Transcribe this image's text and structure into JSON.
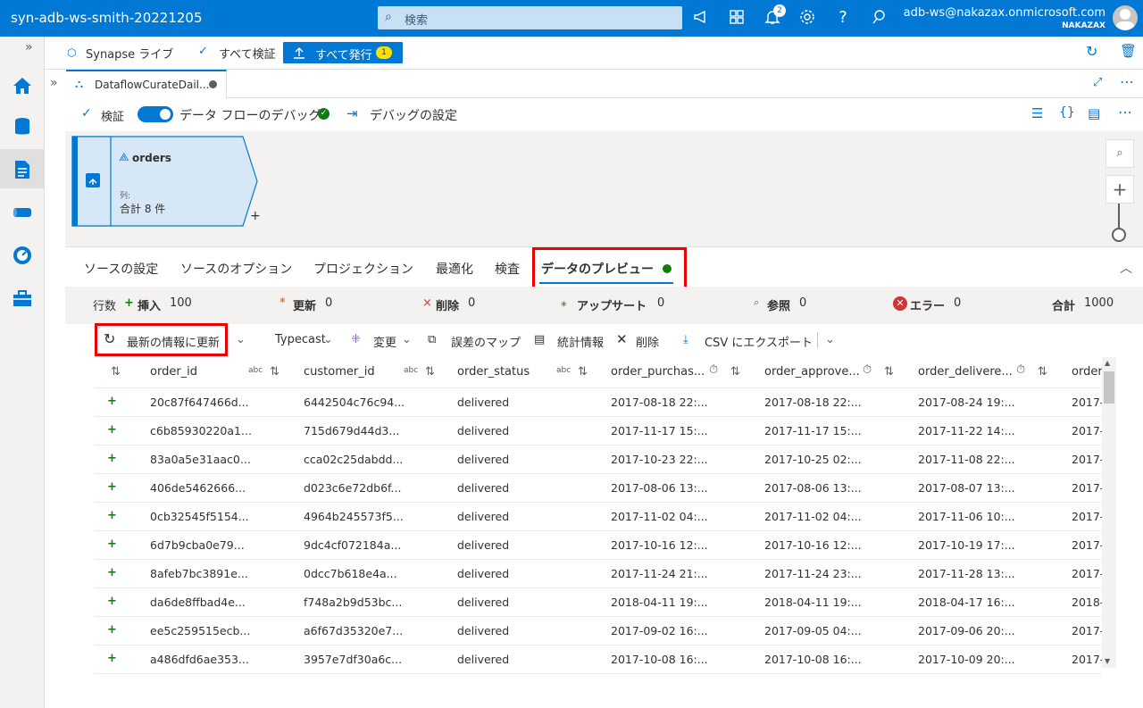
{
  "topbar": {
    "workspace": "syn-adb-ws-smith-20221205",
    "search_placeholder": "検索",
    "notif_count": "2",
    "user_email": "adb-ws@nakazax.onmicrosoft.com",
    "user_tenant": "NAKAZAX"
  },
  "toolbar2": {
    "synapse_live": "Synapse ライブ",
    "validate_all": "すべて検証",
    "publish_all": "すべて発行",
    "publish_count": "1"
  },
  "tab": {
    "title": "DataflowCurateDail..."
  },
  "df_toolbar": {
    "validate": "検証",
    "debug_label": "データ フローのデバッグ",
    "debug_settings": "デバッグの設定"
  },
  "node": {
    "title": "orders",
    "col_label": "列:",
    "total": "合計 8 件",
    "plus": "+"
  },
  "config_tabs": {
    "source_settings": "ソースの設定",
    "source_options": "ソースのオプション",
    "projection": "プロジェクション",
    "optimize": "最適化",
    "inspect": "検査",
    "data_preview": "データのプレビュー"
  },
  "stats": {
    "rows_label": "行数",
    "insert_label": "挿入",
    "insert_val": "100",
    "update_label": "更新",
    "update_val": "0",
    "delete_label": "削除",
    "delete_val": "0",
    "upsert_label": "アップサート",
    "upsert_val": "0",
    "lookup_label": "参照",
    "lookup_val": "0",
    "error_label": "エラー",
    "error_val": "0",
    "total_label": "合計",
    "total_val": "1000"
  },
  "actions": {
    "refresh": "最新の情報に更新",
    "typecast": "Typecast",
    "modify": "変更",
    "map_drifted": "誤差のマップ",
    "statistics": "統計情報",
    "remove": "削除",
    "export_csv": "CSV にエクスポート"
  },
  "grid": {
    "headers": [
      "order_id",
      "customer_id",
      "order_status",
      "order_purchas...",
      "order_approve...",
      "order_delivere...",
      "order_"
    ],
    "type_abc": "abc",
    "rows": [
      [
        "20c87f647466d...",
        "6442504c76c94...",
        "delivered",
        "2017-08-18 22:...",
        "2017-08-18 22:...",
        "2017-08-24 19:...",
        "2017-"
      ],
      [
        "c6b85930220a1...",
        "715d679d44d3...",
        "delivered",
        "2017-11-17 15:...",
        "2017-11-17 15:...",
        "2017-11-22 14:...",
        "2017-"
      ],
      [
        "83a0a5e31aac0...",
        "cca02c25dabdd...",
        "delivered",
        "2017-10-23 22:...",
        "2017-10-25 02:...",
        "2017-11-08 22:...",
        "2017-"
      ],
      [
        "406de5462666...",
        "d023c6e72db6f...",
        "delivered",
        "2017-08-06 13:...",
        "2017-08-06 13:...",
        "2017-08-07 13:...",
        "2017-"
      ],
      [
        "0cb32545f5154...",
        "4964b245573f5...",
        "delivered",
        "2017-11-02 04:...",
        "2017-11-02 04:...",
        "2017-11-06 10:...",
        "2017-"
      ],
      [
        "6d7b9cba0e79...",
        "9dc4cf072184a...",
        "delivered",
        "2017-10-16 12:...",
        "2017-10-16 12:...",
        "2017-10-19 17:...",
        "2017-"
      ],
      [
        "8afeb7bc3891e...",
        "0dcc7b618e4a...",
        "delivered",
        "2017-11-24 21:...",
        "2017-11-24 23:...",
        "2017-11-28 13:...",
        "2017-"
      ],
      [
        "da6de8ffbad4e...",
        "f748a2b9d53bc...",
        "delivered",
        "2018-04-11 19:...",
        "2018-04-11 19:...",
        "2018-04-17 16:...",
        "2018-"
      ],
      [
        "ee5c259515ecb...",
        "a6f67d35320e7...",
        "delivered",
        "2017-09-02 16:...",
        "2017-09-05 04:...",
        "2017-09-06 20:...",
        "2017-"
      ],
      [
        "a486dfd6ae353...",
        "3957e7df30a6c...",
        "delivered",
        "2017-10-08 16:...",
        "2017-10-08 16:...",
        "2017-10-09 20:...",
        "2017-"
      ]
    ]
  },
  "colors": {
    "accent": "#0078d4",
    "highlight": "#ee0000",
    "success": "#107c10"
  }
}
